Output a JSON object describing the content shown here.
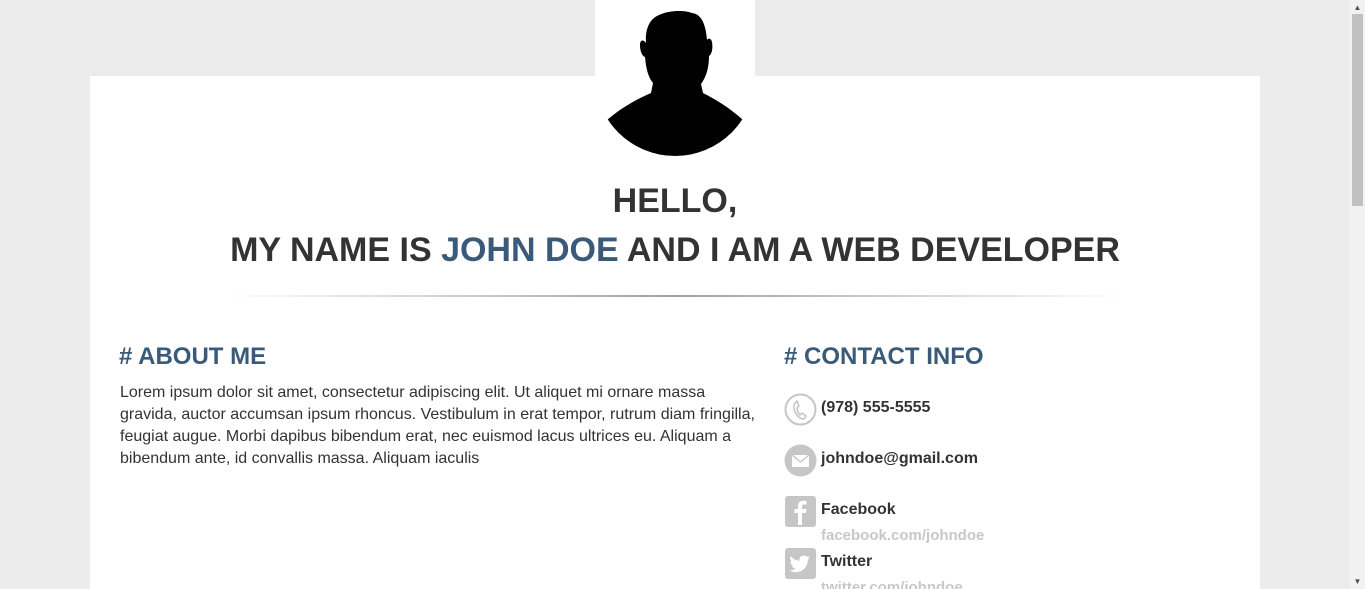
{
  "hero": {
    "greeting": "HELLO,",
    "intro_prefix": "MY NAME IS ",
    "name": "JOHN DOE",
    "intro_suffix": " AND I AM A WEB DEVELOPER",
    "avatar_icon": "user-silhouette-icon"
  },
  "about": {
    "title": "# ABOUT ME",
    "text": "Lorem ipsum dolor sit amet, consectetur adipiscing elit. Ut aliquet mi ornare massa gravida, auctor accumsan ipsum rhoncus. Vestibulum in erat tempor, rutrum diam fringilla, feugiat augue. Morbi dapibus bibendum erat, nec euismod lacus ultrices eu. Aliquam a bibendum ante, id convallis massa. Aliquam iaculis"
  },
  "contact": {
    "title": "# CONTACT INFO",
    "items": [
      {
        "icon": "phone-icon",
        "label": "(978) 555-5555"
      },
      {
        "icon": "mail-icon",
        "label": "johndoe@gmail.com"
      },
      {
        "icon": "facebook-icon",
        "label": "Facebook",
        "sub": "facebook.com/johndoe"
      },
      {
        "icon": "twitter-icon",
        "label": "Twitter",
        "sub": "twitter.com/johndoe"
      }
    ]
  },
  "colors": {
    "background": "#ececec",
    "card": "#ffffff",
    "accent": "#3a5a7a",
    "text": "#333333",
    "muted": "#c8c8c8",
    "icon": "#c6c6c6"
  },
  "scrollbar": {
    "up_arrow": "▲",
    "down_arrow": "▼"
  }
}
